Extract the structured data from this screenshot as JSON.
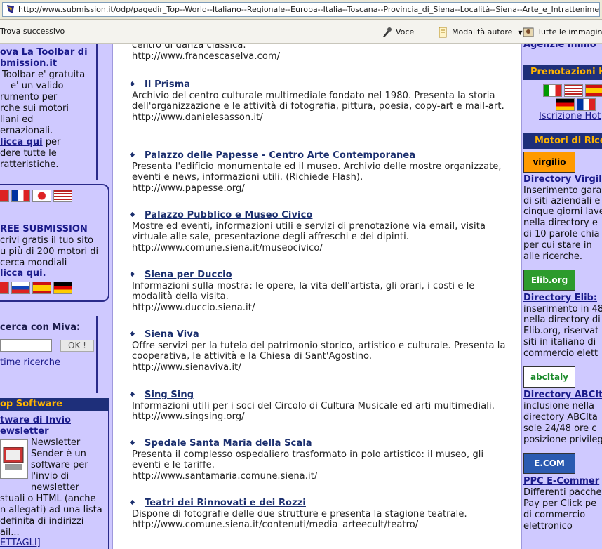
{
  "address_bar": {
    "url": "http://www.submission.it/odp/pagedir_Top--World--Italiano--Regionale--Europa--Italia--Toscana--Provincia_di_Siena--Località--Siena--Arte_e_Intrattenimento.html"
  },
  "toolbar": {
    "find_next": "Trova successivo",
    "voice": "Voce",
    "author_mode": "Modalità autore",
    "all_images": "Tutte le immagini"
  },
  "left": {
    "toolbar_heading": "ova La Toolbar di",
    "toolbar_heading2": "bmission.it",
    "toolbar_text": [
      "Toolbar e' gratuita",
      "e' un valido",
      "rumento per",
      "rche sui motori",
      "liani ed",
      "ernazionali."
    ],
    "click_here": "licca qui",
    "click_suffix": " per",
    "toolbar_text2": [
      "dere tutte le",
      "ratteristiche."
    ],
    "free_title": "REE SUBMISSION",
    "free_text": [
      "crivi gratis il tuo sito",
      "u più di 200 motori di",
      "cerca mondiali"
    ],
    "free_click": "licca qui.",
    "search_label": "cerca con  Miva:",
    "ok_button": "OK !",
    "last_searches": "time ricerche",
    "top_software": "op Software",
    "software_title": "tware di Invio",
    "software_title2": "ewsletter",
    "software_side": [
      "Newsletter",
      "Sender è un",
      "software per",
      "l'invio di",
      "newsletter"
    ],
    "software_text": [
      "stuali o HTML (anche",
      "n allegati) ad una lista",
      "definita di indirizzi",
      "ail..."
    ],
    "details": "ETTAGLI]"
  },
  "main": {
    "top_text": "centro di danza classica.",
    "top_url": "http://www.francescaselva.com/",
    "entries": [
      {
        "title": "Il Prisma",
        "desc": "Archivio del centro culturale multimediale fondato nel 1980. Presenta la storia dell'organizzazione e le attività di fotografia, pittura, poesia, copy-art e mail-art.",
        "url": "http://www.danielesasson.it/"
      },
      {
        "title": "Palazzo delle Papesse - Centro Arte Contemporanea",
        "desc": "Presenta l'edificio monumentale ed il museo. Archivio delle mostre organizzate, eventi e news, informazioni utili. (Richiede Flash).",
        "url": "http://www.papesse.org/"
      },
      {
        "title": "Palazzo Pubblico e Museo Civico",
        "desc": "Mostre ed eventi, informazioni utili e servizi di prenotazione via email, visita virtuale alle sale, presentazione degli affreschi e dei dipinti.",
        "url": "http://www.comune.siena.it/museocivico/"
      },
      {
        "title": "Siena per Duccio",
        "desc": "Informazioni sulla mostra: le opere, la vita dell'artista, gli orari, i costi e le modalità della visita.",
        "url": "http://www.duccio.siena.it/"
      },
      {
        "title": "Siena Viva",
        "desc": "Offre servizi per la tutela del patrimonio storico, artistico e culturale. Presenta la cooperativa, le attività e la Chiesa di Sant'Agostino.",
        "url": "http://www.sienaviva.it/"
      },
      {
        "title": "Sing Sing",
        "desc": "Informazioni utili per i soci del Circolo di Cultura Musicale ed arti multimediali.",
        "url": "http://www.singsing.org/"
      },
      {
        "title": "Spedale Santa Maria della Scala",
        "desc": "Presenta il complesso ospedaliero trasformato in polo artistico: il museo, gli eventi e le tariffe.",
        "url": "http://www.santamaria.comune.siena.it/"
      },
      {
        "title": "Teatri dei Rinnovati e dei Rozzi",
        "desc": "Dispone di fotografie delle due strutture e presenta la stagione teatrale.",
        "url": "http://www.comune.siena.it/contenuti/media_arteecult/teatro/"
      }
    ]
  },
  "right": {
    "agenzie": "Agenzie Immo",
    "prenotazioni": "Prenotazioni H",
    "iscrizione": "Iscrizione Hot",
    "motori": "Motori di Rice",
    "virgilio_logo": "virgilio",
    "virgilio_title": "Directory Virgili",
    "virgilio_text": [
      "Inserimento gara",
      "di siti aziendali e",
      "cinque giorni lave",
      "nella directory e",
      "di 10 parole chia",
      "per cui stare in",
      "alle ricerche."
    ],
    "elib_logo": "Elib.org",
    "elib_title": "Directory Elib:",
    "elib_text": [
      "inserimento in 48",
      "nella directory di",
      "Elib.org, riservat",
      "siti in italiano di",
      "commercio elett"
    ],
    "abc_logo": "abcItaly",
    "abc_title": "Directory ABCIt",
    "abc_text": [
      "inclusione nella",
      "directory ABCIta",
      "sole 24/48 ore c",
      "posizione privileg"
    ],
    "ecom_logo": "E.COM",
    "ppc_title": "PPC E-Commer",
    "ppc_text": [
      "Differenti pacche",
      "Pay per Click pe",
      "di commercio",
      "elettronico"
    ]
  }
}
